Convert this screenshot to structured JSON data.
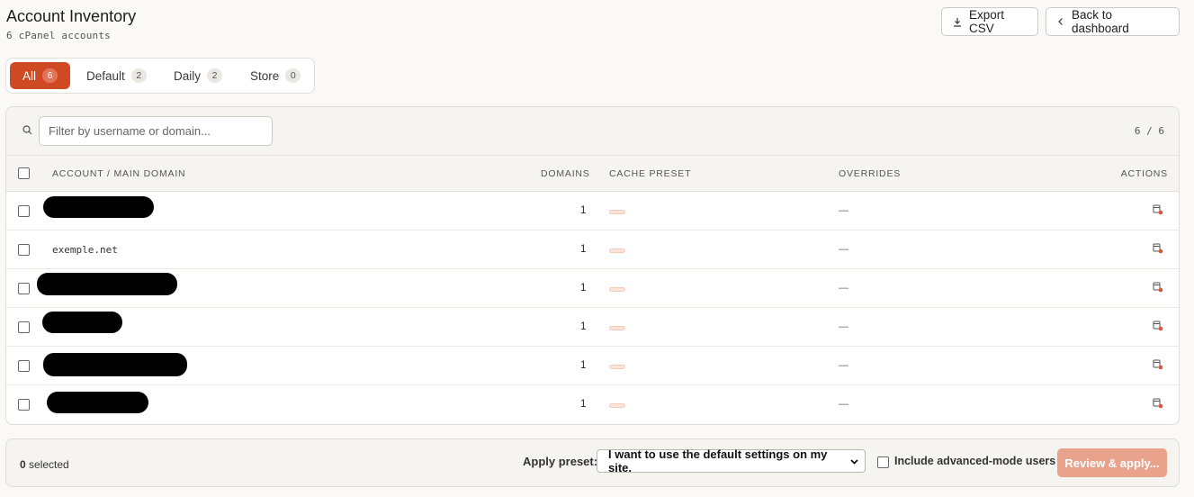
{
  "header": {
    "title": "Account Inventory",
    "subtitle": "6 cPanel accounts",
    "export_label": "Export CSV",
    "back_label": "Back to dashboard"
  },
  "tabs": [
    {
      "label": "All",
      "count": "6",
      "active": true
    },
    {
      "label": "Default",
      "count": "2"
    },
    {
      "label": "Daily",
      "count": "2"
    },
    {
      "label": "Store",
      "count": "0"
    }
  ],
  "search": {
    "placeholder": "Filter by username or domain...",
    "count": "6 / 6"
  },
  "table": {
    "headers": {
      "account": "ACCOUNT / MAIN DOMAIN",
      "domains": "DOMAINS",
      "cache": "CACHE PRESET",
      "overrides": "OVERRIDES",
      "actions": "ACTIONS"
    },
    "rows": [
      {
        "account": "",
        "domains": "1",
        "override": "—",
        "redacted": true
      },
      {
        "account": "exemple.net",
        "domains": "1",
        "override": "—",
        "redacted": false
      },
      {
        "account": "",
        "domains": "1",
        "override": "—",
        "redacted": true
      },
      {
        "account": "",
        "domains": "1",
        "override": "—",
        "redacted": true
      },
      {
        "account": "",
        "domains": "1",
        "override": "—",
        "redacted": true
      },
      {
        "account": "",
        "domains": "1",
        "override": "—",
        "redacted": true
      }
    ]
  },
  "footer": {
    "selected_count": "0",
    "selected_label": "selected",
    "apply_label": "Apply preset:",
    "preset_value": "I want to use the default settings on my site.",
    "advanced_label": "Include advanced-mode users",
    "review_label": "Review & apply..."
  },
  "colors": {
    "accent": "#cf4a22",
    "accent_disabled": "#e9a28c"
  }
}
